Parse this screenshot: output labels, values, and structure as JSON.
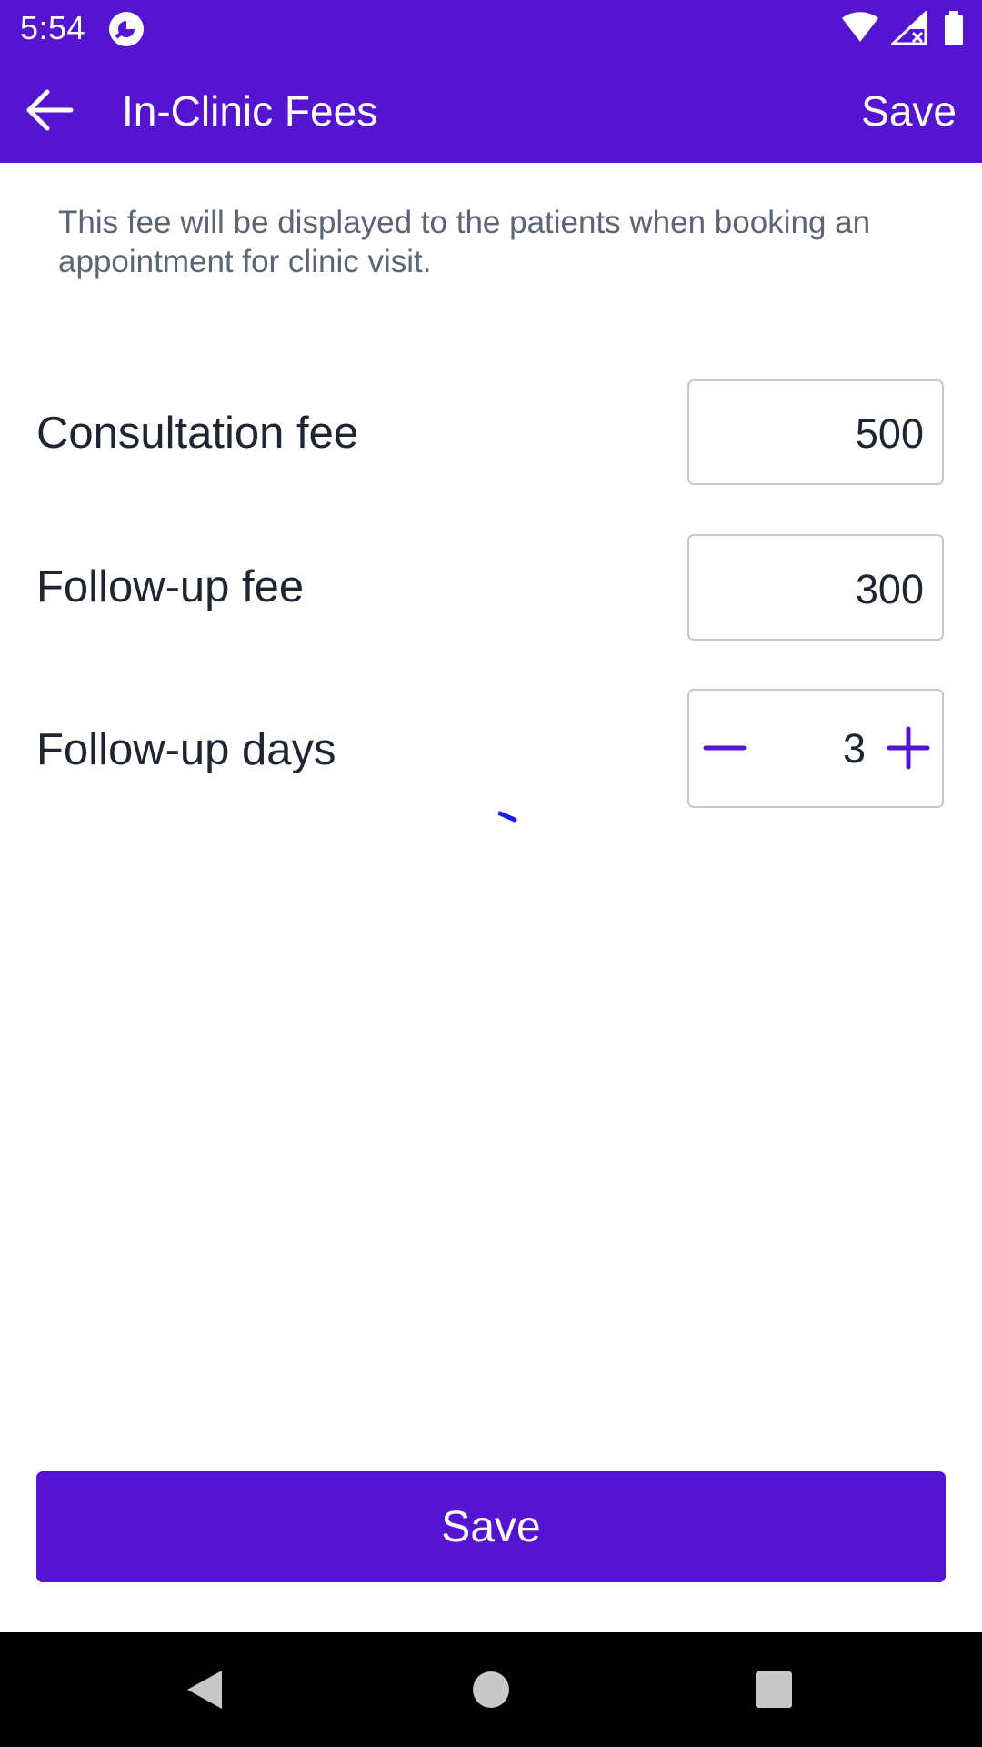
{
  "status_bar": {
    "time": "5:54",
    "icons": [
      "app-notification-icon",
      "wifi-icon",
      "signal-icon",
      "battery-icon"
    ]
  },
  "app_bar": {
    "title": "In-Clinic Fees",
    "save_label": "Save",
    "back_icon": "arrow-left-icon"
  },
  "description": "This fee will be displayed to the patients when booking an appointment for clinic visit.",
  "fields": {
    "consultation_fee": {
      "label": "Consultation fee",
      "value": "500"
    },
    "follow_up_fee": {
      "label": "Follow-up fee",
      "value": "300"
    },
    "follow_up_days": {
      "label": "Follow-up days",
      "value": "3",
      "decrement_icon": "minus-icon",
      "increment_icon": "plus-icon"
    }
  },
  "bottom_button": {
    "label": "Save"
  },
  "nav_bar": {
    "icons": [
      "nav-back-icon",
      "nav-home-icon",
      "nav-recents-icon"
    ]
  },
  "colors": {
    "primary": "#5514d0",
    "text_dark": "#1e2430",
    "text_muted": "#5b6573",
    "border": "#c4c8cf",
    "spinner": "#1a1aff"
  }
}
